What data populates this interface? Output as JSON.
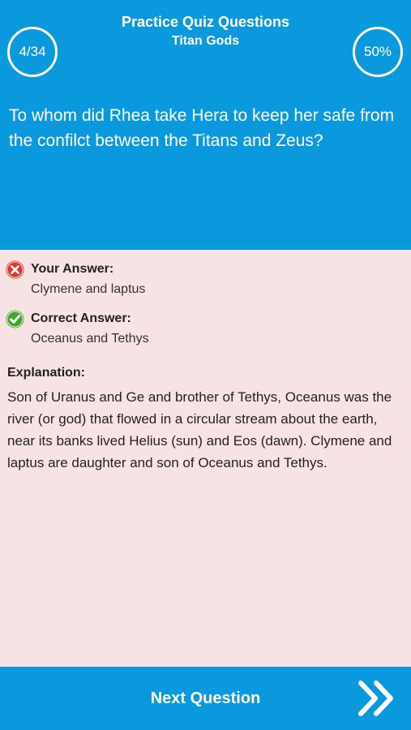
{
  "header": {
    "title": "Practice Quiz Questions",
    "subtitle": "Titan Gods",
    "progress_count": "4/34",
    "score_percent": "50%"
  },
  "question": {
    "text": "To whom did Rhea take Hera to keep her safe from the confilct between the Titans and Zeus?"
  },
  "your_answer": {
    "label": "Your Answer:",
    "value": "Clymene and laptus",
    "icon": "x-circle-icon",
    "color": "#e0342c"
  },
  "correct_answer": {
    "label": "Correct Answer:",
    "value": "Oceanus and Tethys",
    "icon": "check-circle-icon",
    "color": "#43a82a"
  },
  "explanation": {
    "label": "Explanation:",
    "text": "Son of Uranus and Ge and brother of Tethys, Oceanus was the river (or god) that flowed in a circular stream about the earth, near its banks lived Helius (sun) and Eos (dawn). Clymene and laptus are daughter and son of Oceanus and Tethys."
  },
  "footer": {
    "next_label": "Next Question",
    "icon": "double-chevron-right-icon"
  },
  "colors": {
    "accent": "#0a99dc",
    "background": "#f8e3e4"
  }
}
